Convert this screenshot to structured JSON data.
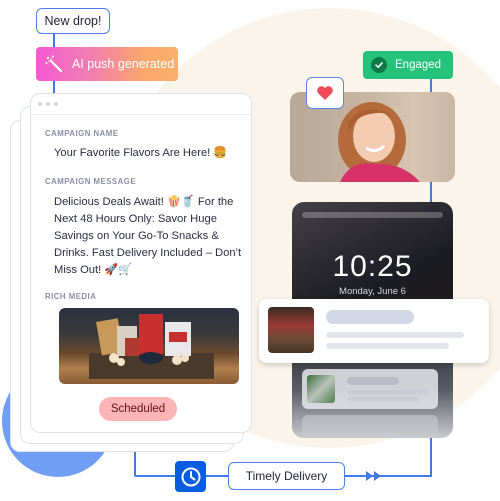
{
  "flow": {
    "trigger_tag": "New drop!",
    "ai_tag": "AI push generated",
    "ai_icon": "magic-wand-icon",
    "engaged_tag": "Engaged",
    "engaged_icon": "check-circle-icon",
    "reaction_icon": "heart-icon",
    "delivery_icon": "clock-icon",
    "delivery_label": "Timely Delivery"
  },
  "campaign_card": {
    "name_label": "CAMPAIGN NAME",
    "name_value": "Your Favorite Flavors Are Here! 🍔",
    "message_label": "CAMPAIGN MESSAGE",
    "message_value": "Delicious Deals Await! 🍿🥤 For the Next 48 Hours Only: Savor Huge Savings on Your Go-To Snacks & Drinks. Fast Delivery Included – Don’t Miss Out! 🚀🛒",
    "media_label": "RICH MEDIA",
    "media_alt": "Snack gift basket with popcorn and chips",
    "status": "Scheduled"
  },
  "phone": {
    "time": "10:25",
    "date": "Monday, June 6"
  },
  "colors": {
    "accent_blue": "#3f7ae6",
    "engaged_green": "#24c27a",
    "scheduled_pink": "#fbb5b5",
    "clock_blue": "#0b5de0"
  }
}
